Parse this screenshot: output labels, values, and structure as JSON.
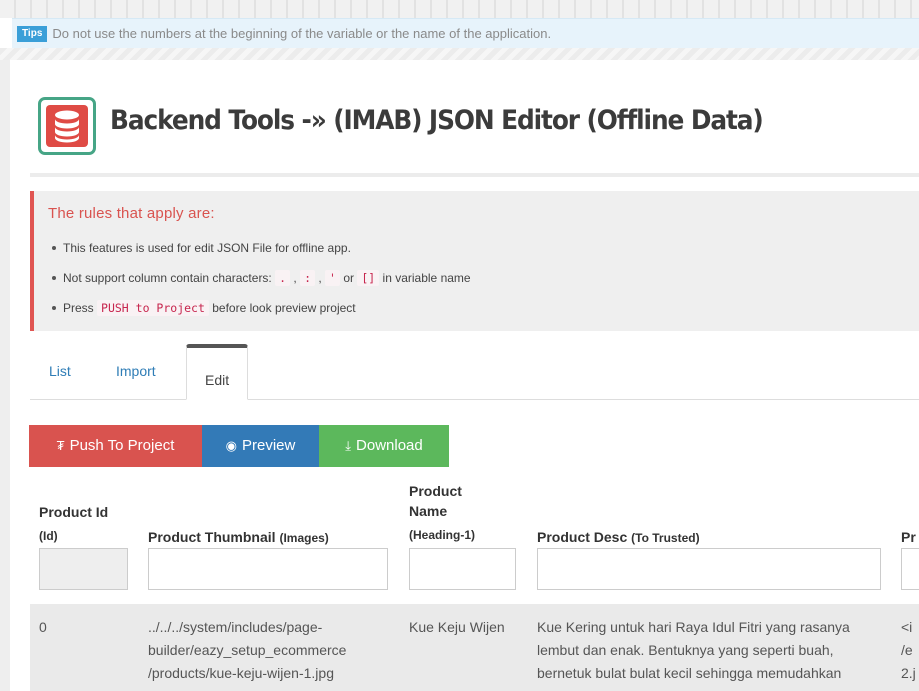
{
  "tips": {
    "badge": "Tips",
    "text": "Do not use the numbers at the beginning of the variable or the name of the application."
  },
  "header": {
    "icon": "database-icon",
    "title": "Backend Tools -» (IMAB) JSON Editor (Offline Data)"
  },
  "rules": {
    "heading": "The rules that apply are:",
    "item1": "This features is used for edit JSON File for offline app.",
    "item2_prefix": "Not support column contain characters:",
    "item2_chars": [
      ".",
      ":",
      "'"
    ],
    "item2_or": "or",
    "item2_brackets": "[]",
    "item2_suffix": "in variable name",
    "item3_prefix": "Press",
    "item3_code": "PUSH to Project",
    "item3_suffix": "before look preview project"
  },
  "tabs": [
    {
      "label": "List",
      "active": false
    },
    {
      "label": "Import",
      "active": false
    },
    {
      "label": "Edit",
      "active": true
    }
  ],
  "buttons": {
    "push": "Push To Project",
    "preview": "Preview",
    "download": "Download"
  },
  "colors": {
    "push": "#d9534f",
    "preview": "#337ab7",
    "download": "#5cb85c",
    "accent": "#46a586"
  },
  "table": {
    "columns": [
      {
        "title": "Product Id",
        "hint": "(Id)"
      },
      {
        "title": "Product Thumbnail",
        "hint": "(Images)"
      },
      {
        "title_line1": "Product",
        "title_line2": "Name",
        "hint": "(Heading-1)"
      },
      {
        "title": "Product Desc",
        "hint": "(To Trusted)"
      },
      {
        "title": "Pr"
      }
    ],
    "rows": [
      {
        "id": "0",
        "thumb_lines": [
          "../../../system/includes/page-",
          "builder/eazy_setup_ecommerce",
          "/products/kue-keju-wijen-1.jpg"
        ],
        "name": "Kue Keju Wijen",
        "desc_lines": [
          "Kue Kering untuk hari Raya Idul Fitri yang rasanya",
          "lembut dan enak. Bentuknya yang seperti buah,",
          "bernetuk bulat bulat kecil sehingga memudahkan"
        ],
        "extra_lines": [
          "<i",
          "/e",
          "2.j"
        ]
      }
    ]
  }
}
